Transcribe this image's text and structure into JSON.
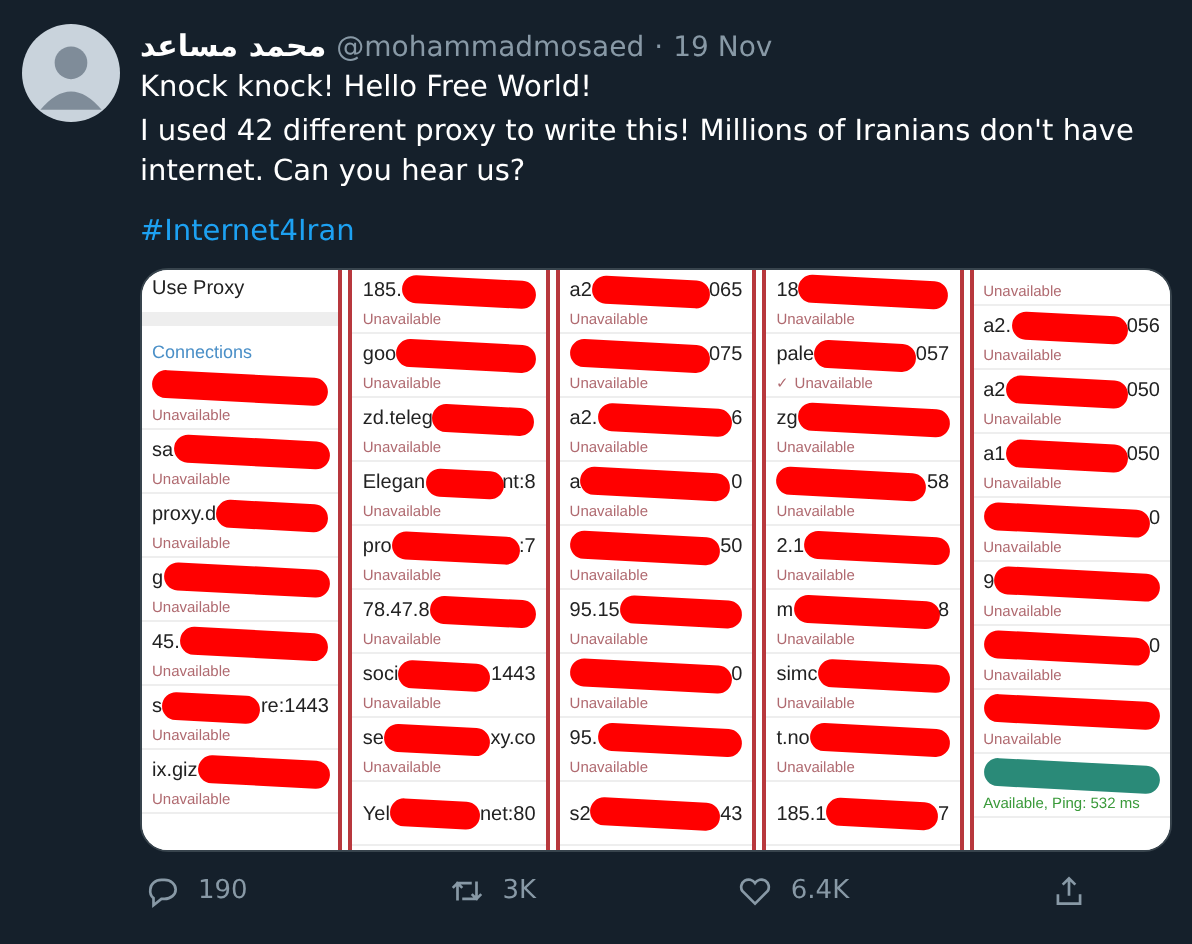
{
  "tweet": {
    "author": {
      "name": "محمد مساعد",
      "handle": "@mohammadmosaed",
      "separator": "·",
      "date": "19 Nov"
    },
    "text": [
      "Knock knock! Hello Free World!",
      "I used 42 different proxy to write this! Millions of Iranians don't have internet. Can you hear us?"
    ],
    "hashtag": "#Internet4Iran",
    "media": {
      "panels": [
        {
          "header": "Use Proxy",
          "section": "Connections",
          "rows": [
            {
              "prefix": "",
              "suffix": "",
              "status": "Unavailable",
              "available": false,
              "color": "#ff0000"
            },
            {
              "prefix": "sa",
              "suffix": "",
              "status": "Unavailable",
              "available": false,
              "color": "#ff0000"
            },
            {
              "prefix": "proxy.d",
              "suffix": "",
              "status": "Unavailable",
              "available": false,
              "color": "#ff0000"
            },
            {
              "prefix": "g",
              "suffix": "",
              "status": "Unavailable",
              "available": false,
              "color": "#ff0000"
            },
            {
              "prefix": "45.",
              "suffix": "",
              "status": "Unavailable",
              "available": false,
              "color": "#ff0000"
            },
            {
              "prefix": "s",
              "suffix": "re:1443",
              "status": "Unavailable",
              "available": false,
              "color": "#ff0000"
            },
            {
              "prefix": "ix.giz",
              "suffix": "",
              "status": "Unavailable",
              "available": false,
              "color": "#ff0000"
            }
          ]
        },
        {
          "rows": [
            {
              "prefix": "185.",
              "suffix": "",
              "status": "Unavailable",
              "available": false,
              "color": "#ff0000"
            },
            {
              "prefix": "goo",
              "suffix": "",
              "status": "Unavailable",
              "available": false,
              "color": "#ff0000"
            },
            {
              "prefix": "zd.teleg",
              "suffix": "",
              "status": "Unavailable",
              "available": false,
              "color": "#ff0000"
            },
            {
              "prefix": "Elegan",
              "suffix": "nt:8",
              "status": "Unavailable",
              "available": false,
              "color": "#ff0000"
            },
            {
              "prefix": "pro",
              "suffix": ":7",
              "status": "Unavailable",
              "available": false,
              "color": "#ff0000"
            },
            {
              "prefix": "78.47.8",
              "suffix": "",
              "status": "Unavailable",
              "available": false,
              "color": "#ff0000"
            },
            {
              "prefix": "soci",
              "suffix": "1443",
              "status": "Unavailable",
              "available": false,
              "color": "#ff0000"
            },
            {
              "prefix": "se",
              "suffix": "xy.co",
              "status": "Unavailable",
              "available": false,
              "color": "#ff0000"
            },
            {
              "prefix": "Yel",
              "suffix": "net:80",
              "color": "#ff0000"
            }
          ]
        },
        {
          "rows": [
            {
              "prefix": "a2",
              "suffix": "065",
              "status": "Unavailable",
              "available": false,
              "color": "#ff0000"
            },
            {
              "prefix": "",
              "suffix": "075",
              "status": "Unavailable",
              "available": false,
              "color": "#ff0000"
            },
            {
              "prefix": "a2.",
              "suffix": "6",
              "status": "Unavailable",
              "available": false,
              "color": "#ff0000"
            },
            {
              "prefix": "a",
              "suffix": "0",
              "status": "Unavailable",
              "available": false,
              "color": "#ff0000"
            },
            {
              "prefix": "",
              "suffix": "50",
              "status": "Unavailable",
              "available": false,
              "color": "#ff0000"
            },
            {
              "prefix": "95.15",
              "suffix": "",
              "status": "Unavailable",
              "available": false,
              "color": "#ff0000"
            },
            {
              "prefix": "",
              "suffix": "0",
              "status": "Unavailable",
              "available": false,
              "color": "#ff0000"
            },
            {
              "prefix": "95.",
              "suffix": "",
              "status": "Unavailable",
              "available": false,
              "color": "#ff0000"
            },
            {
              "prefix": "s2",
              "suffix": "43",
              "color": "#ff0000"
            }
          ]
        },
        {
          "rows": [
            {
              "prefix": "18",
              "suffix": "",
              "status": "Unavailable",
              "available": false,
              "color": "#ff0000"
            },
            {
              "prefix": "pale",
              "suffix": "057",
              "status": "✓ Unavailable",
              "available": false,
              "color": "#ff0000"
            },
            {
              "prefix": "zg",
              "suffix": "",
              "status": "Unavailable",
              "available": false,
              "color": "#ff0000"
            },
            {
              "prefix": "",
              "suffix": "58",
              "status": "Unavailable",
              "available": false,
              "color": "#ff0000"
            },
            {
              "prefix": "2.1",
              "suffix": "",
              "status": "Unavailable",
              "available": false,
              "color": "#ff0000"
            },
            {
              "prefix": "m",
              "suffix": "8",
              "status": "Unavailable",
              "available": false,
              "color": "#ff0000"
            },
            {
              "prefix": "simc",
              "suffix": "",
              "status": "Unavailable",
              "available": false,
              "color": "#ff0000"
            },
            {
              "prefix": "t.no",
              "suffix": "",
              "status": "Unavailable",
              "available": false,
              "color": "#ff0000"
            },
            {
              "prefix": "185.1",
              "suffix": "7",
              "color": "#ff0000"
            }
          ]
        },
        {
          "rows": [
            {
              "prefix": "",
              "suffix": "",
              "status": "Unavailable",
              "available": false
            },
            {
              "prefix": "a2.",
              "suffix": "056",
              "status": "Unavailable",
              "available": false,
              "color": "#ff0000"
            },
            {
              "prefix": "a2",
              "suffix": "050",
              "status": "Unavailable",
              "available": false,
              "color": "#ff0000"
            },
            {
              "prefix": "a1",
              "suffix": "050",
              "status": "Unavailable",
              "available": false,
              "color": "#ff0000"
            },
            {
              "prefix": "",
              "suffix": "0",
              "status": "Unavailable",
              "available": false,
              "color": "#ff0000"
            },
            {
              "prefix": "9",
              "suffix": "",
              "status": "Unavailable",
              "available": false,
              "color": "#ff0000"
            },
            {
              "prefix": "",
              "suffix": "0",
              "status": "Unavailable",
              "available": false,
              "color": "#ff0000"
            },
            {
              "prefix": "",
              "suffix": "",
              "status": "Unavailable",
              "available": false,
              "color": "#ff0000"
            },
            {
              "prefix": "",
              "suffix": "",
              "status": "Available, Ping: 532 ms",
              "available": true,
              "color": "#2a8a78"
            }
          ]
        }
      ]
    },
    "actions": [
      {
        "kind": "reply",
        "count": "190"
      },
      {
        "kind": "retweet",
        "count": "3K"
      },
      {
        "kind": "like",
        "count": "6.4K"
      },
      {
        "kind": "share"
      }
    ]
  }
}
